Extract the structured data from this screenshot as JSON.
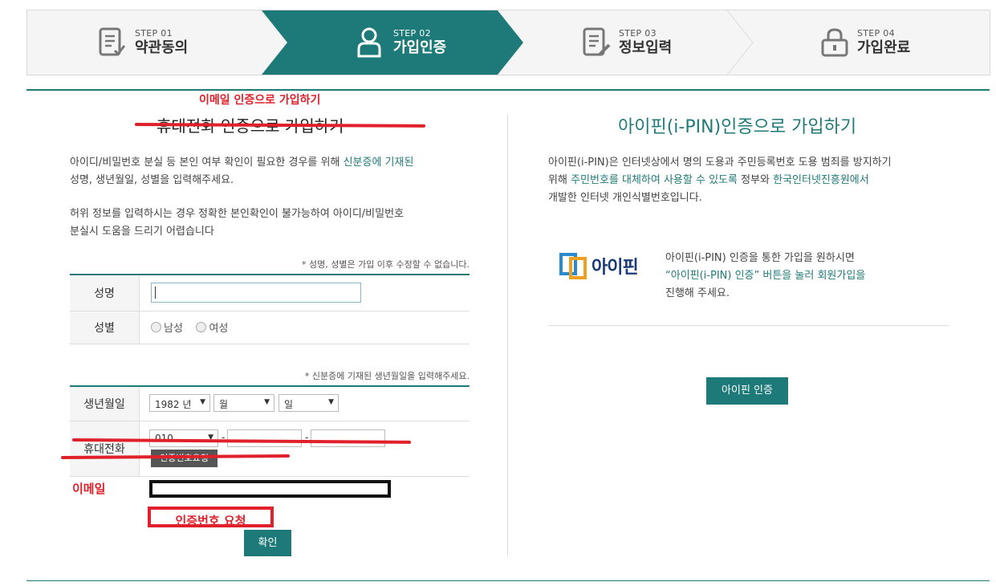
{
  "steps": [
    {
      "step": "STEP 01",
      "label": "약관동의",
      "icon": "document-check-icon"
    },
    {
      "step": "STEP 02",
      "label": "가입인증",
      "icon": "user-icon"
    },
    {
      "step": "STEP 03",
      "label": "정보입력",
      "icon": "document-edit-icon"
    },
    {
      "step": "STEP 04",
      "label": "가입완료",
      "icon": "lock-icon"
    }
  ],
  "colors": {
    "accent": "#1d7a78",
    "annotation_red": "#e0202a"
  },
  "left": {
    "email_title": "이메일 인증으로 가입하기",
    "phone_title": "휴대전화 인증으로 가입하기",
    "para1_a": "아이디/비밀번호 분실 등 본인 여부 확인이 필요한 경우를 위해 ",
    "para1_b": "신분증에 기재된",
    "para1_c": "성명, 생년월일, 성별을 입력해주세요.",
    "para2_a": "허위 정보를 입력하시는 경우 정확한 본인확인이 불가능하여 아이디/비밀번호",
    "para2_b": "분실시 도움을 드리기 어렵습니다",
    "note1": "* 성명, 성별은 가입 이후 수정할 수 없습니다.",
    "name_label": "성명",
    "name_value": "",
    "gender_label": "성별",
    "gender_options": [
      "남성",
      "여성"
    ],
    "note2": "* 신분증에 기재된 생년월일을 입력해주세요.",
    "birth_label": "생년월일",
    "birth_year": "1982 년",
    "birth_month": "월",
    "birth_day": "일",
    "phone_label": "휴대전화",
    "phone_prefix": "010",
    "phone_dash": "-",
    "phone_request_btn": "인증번호요청",
    "email_label": "이메일",
    "email_value": "",
    "email_request_btn": "인증번호 요청",
    "confirm_btn": "확인"
  },
  "right": {
    "title": "아이핀(i-PIN)인증으로 가입하기",
    "para_a": "아이핀(i-PIN)은 인터넷상에서 명의 도용과 주민등록번호 도용 범죄를 방지하기",
    "para_b1": "위해 ",
    "para_b2": "주민번호를 대체하여 사용할 수 있도록",
    "para_b3": " 정부와 ",
    "para_b4": "한국인터넷진흥원에서",
    "para_c": "개발한 인터넷 개인식별번호입니다.",
    "logo_text": "아이핀",
    "desc_a": "아이핀(i-PIN) 인증을 통한 가입을 원하시면",
    "desc_b": "“아이핀(i-PIN) 인증” 버튼을 눌러 회원가입을",
    "desc_c": "진행해 주세요.",
    "ipin_btn": "아이핀 인증"
  }
}
